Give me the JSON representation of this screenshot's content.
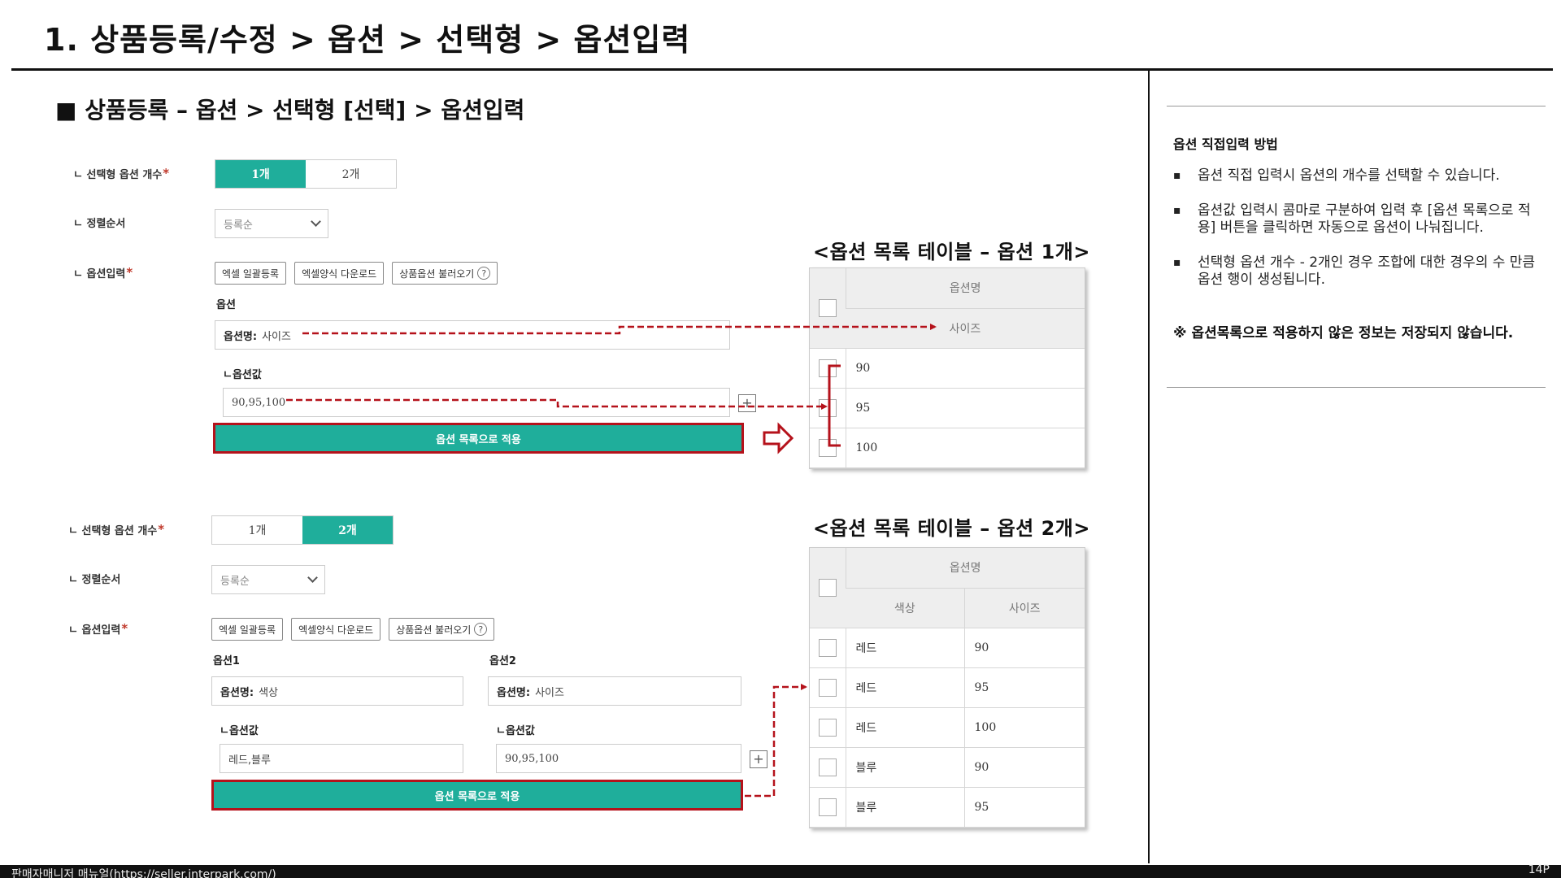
{
  "page_title": "1. 상품등록/수정 > 옵션 > 선택형 > 옵션입력",
  "section_heading": "■ 상품등록 – 옵션 > 선택형 [선택] > 옵션입력",
  "accent_color": "#1fae9b",
  "highlight_color": "#b5121b",
  "form1": {
    "count_label": "ㄴ 선택형 옵션 개수",
    "required_mark": "*",
    "count_options": [
      "1개",
      "2개"
    ],
    "count_selected": "1개",
    "sort_label": "ㄴ 정렬순서",
    "sort_value": "등록순",
    "input_label": "ㄴ 옵션입력",
    "btn_excel_bulk": "엑셀 일괄등록",
    "btn_excel_download": "엑셀양식 다운로드",
    "btn_load_options": "상품옵션 불러오기",
    "help_icon": "?",
    "option_label": "옵션",
    "option_name_key": "옵션명:",
    "option_name_value": "사이즈",
    "option_value_label": "ㄴ옵션값",
    "option_value": "90,95,100",
    "plus_icon": "+",
    "apply_button": "옵션 목록으로 적용"
  },
  "table1": {
    "title": "<옵션 목록 테이블 – 옵션 1개>",
    "header": "옵션명",
    "subheader": "사이즈",
    "rows": [
      "90",
      "95",
      "100"
    ]
  },
  "form2": {
    "count_label": "ㄴ 선택형 옵션 개수",
    "required_mark": "*",
    "count_options": [
      "1개",
      "2개"
    ],
    "count_selected": "2개",
    "sort_label": "ㄴ 정렬순서",
    "sort_value": "등록순",
    "input_label": "ㄴ 옵션입력",
    "btn_excel_bulk": "엑셀 일괄등록",
    "btn_excel_download": "엑셀양식 다운로드",
    "btn_load_options": "상품옵션 불러오기",
    "help_icon": "?",
    "option1_label": "옵션1",
    "option2_label": "옵션2",
    "option_name_key": "옵션명:",
    "option1_name_value": "색상",
    "option2_name_value": "사이즈",
    "option_value_label": "ㄴ옵션값",
    "option1_value": "레드,블루",
    "option2_value": "90,95,100",
    "plus_icon": "+",
    "apply_button": "옵션 목록으로 적용"
  },
  "table2": {
    "title": "<옵션 목록 테이블 – 옵션 2개>",
    "header": "옵션명",
    "subheaders": [
      "색상",
      "사이즈"
    ],
    "rows": [
      [
        "레드",
        "90"
      ],
      [
        "레드",
        "95"
      ],
      [
        "레드",
        "100"
      ],
      [
        "블루",
        "90"
      ],
      [
        "블루",
        "95"
      ]
    ]
  },
  "notes": {
    "title": "옵션 직접입력 방법",
    "items": [
      "옵션 직접 입력시 옵션의 개수를 선택할 수 있습니다.",
      "옵션값 입력시 콤마로 구분하여 입력 후 [옵션 목록으로 적용] 버튼을 클릭하면 자동으로 옵션이 나눠집니다.",
      "선택형 옵션 개수 - 2개인 경우 조합에 대한 경우의 수 만큼 옵션 행이 생성됩니다."
    ],
    "warning": "※ 옵션목록으로 적용하지 않은 정보는 저장되지 않습니다."
  },
  "footer": {
    "left": "판매자매니저 매뉴얼(https://seller.interpark.com/)",
    "page": "14P"
  }
}
